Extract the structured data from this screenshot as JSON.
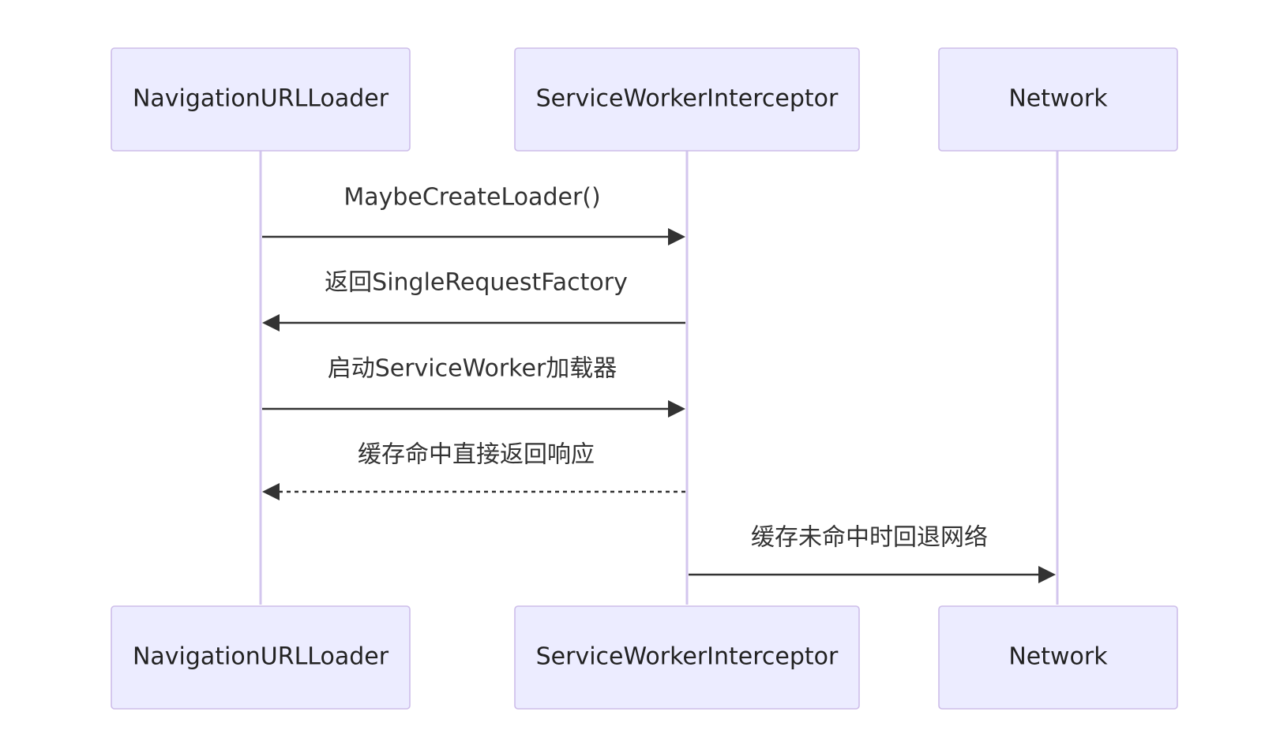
{
  "participants": [
    {
      "id": "loader",
      "label": "NavigationURLLoader"
    },
    {
      "id": "interceptor",
      "label": "ServiceWorkerInterceptor"
    },
    {
      "id": "network",
      "label": "Network"
    }
  ],
  "messages": [
    {
      "from": "loader",
      "to": "interceptor",
      "label": "MaybeCreateLoader()",
      "style": "solid"
    },
    {
      "from": "interceptor",
      "to": "loader",
      "label": "返回SingleRequestFactory",
      "style": "solid"
    },
    {
      "from": "loader",
      "to": "interceptor",
      "label": "启动ServiceWorker加载器",
      "style": "solid"
    },
    {
      "from": "interceptor",
      "to": "loader",
      "label": "缓存命中直接返回响应",
      "style": "dotted"
    },
    {
      "from": "interceptor",
      "to": "network",
      "label": "缓存未命中时回退网络",
      "style": "solid"
    }
  ],
  "colors": {
    "actor_fill": "#ececff",
    "actor_stroke": "#cdbde9",
    "lifeline": "#d3c6ee",
    "message": "#333333"
  }
}
